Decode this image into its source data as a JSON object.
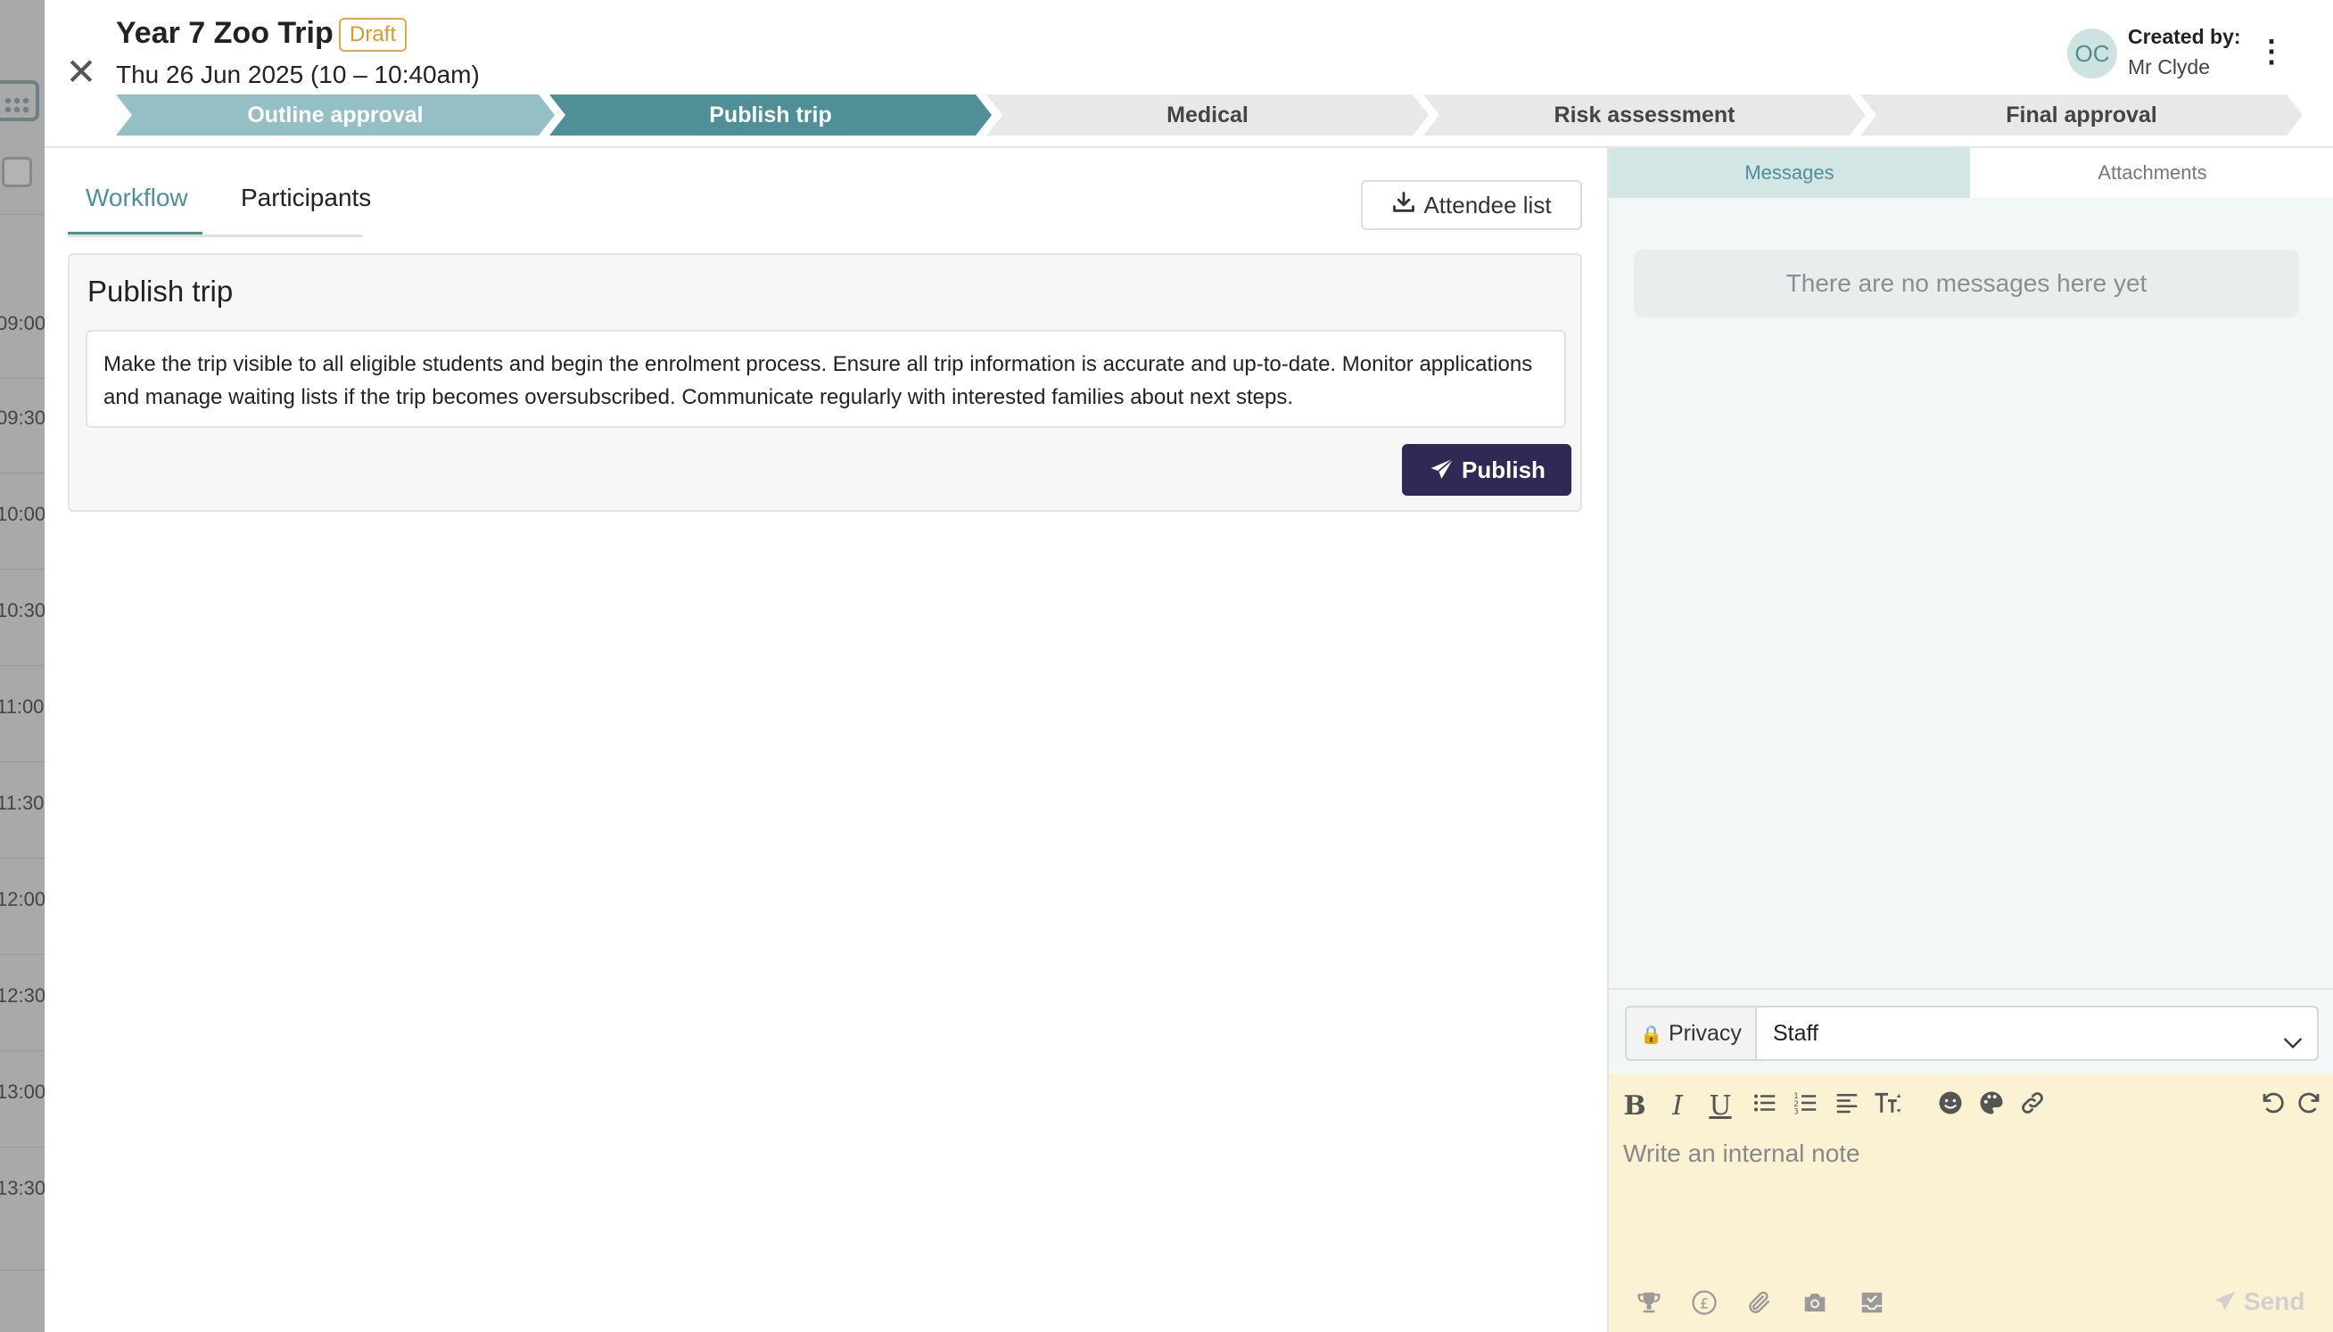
{
  "header": {
    "title": "Year 7 Zoo Trip",
    "status_badge": "Draft",
    "date": "Thu 26 Jun 2025 (10 – 10:40am)",
    "avatar_initials": "OC",
    "created_by_label": "Created by:",
    "created_by_name": "Mr Clyde"
  },
  "stepper": [
    {
      "label": "Outline approval",
      "state": "done"
    },
    {
      "label": "Publish trip",
      "state": "active"
    },
    {
      "label": "Medical",
      "state": "todo"
    },
    {
      "label": "Risk assessment",
      "state": "todo"
    },
    {
      "label": "Final approval",
      "state": "todo"
    }
  ],
  "tabs": {
    "workflow": "Workflow",
    "participants": "Participants",
    "active": "Workflow"
  },
  "attendee_button": "Attendee list",
  "panel": {
    "title": "Publish trip",
    "description": "Make the trip visible to all eligible students and begin the enrolment process. Ensure all trip information is accurate and up-to-date. Monitor applications and manage waiting lists if the trip becomes oversubscribed. Communicate regularly with interested families about next steps.",
    "publish_label": "Publish"
  },
  "messages": {
    "tab_messages": "Messages",
    "tab_attachments": "Attachments",
    "empty_text": "There are no messages here yet",
    "privacy_label": "Privacy",
    "privacy_value": "Staff",
    "placeholder": "Write an internal note",
    "send_label": "Send"
  },
  "background_calendar": {
    "times": [
      "09:00",
      "09:30",
      "10:00",
      "10:30",
      "11:00",
      "11:30",
      "12:00",
      "12:30",
      "13:00",
      "13:30"
    ]
  },
  "colors": {
    "accent": "#4f8f97",
    "step_done": "#94bfc4",
    "primary_button": "#2f2a55",
    "draft_badge": "#d89a30",
    "editor_bg": "#faf2d3"
  },
  "icons": {
    "close": "close-icon",
    "kebab": "more-vertical-icon",
    "download": "download-icon",
    "publish": "paper-plane-icon",
    "privacy": "lock-icon",
    "select": "chevron-down-icon"
  }
}
